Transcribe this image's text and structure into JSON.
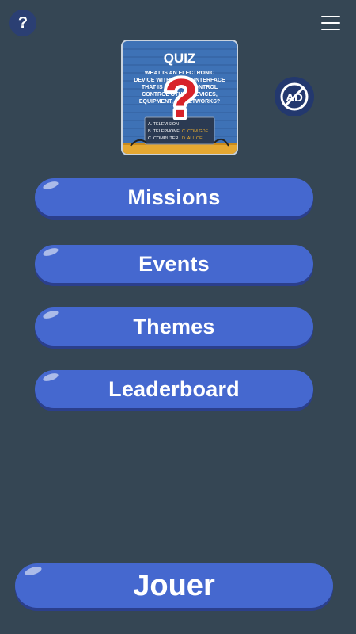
{
  "header": {
    "help_icon": "question-icon",
    "help_glyph": "?",
    "menu_icon": "hamburger-icon",
    "no_ads_icon": "no-ads-icon",
    "no_ads_text": "AD"
  },
  "logo": {
    "title": "QUIZ",
    "question_lines": [
      "WHAT IS AN ELECTRONIC",
      "DEVICE WITH A USER INTERFACE",
      "THAT IS USED TO CONTROL",
      "CONTROL OTHER DEVICES,",
      "EQUIPMENT, OR NETWORKS?"
    ],
    "answers": [
      "A. TELEVISION",
      "B. TELEPHONE",
      "C. COMPUTER",
      "C. COM GDF",
      "D. ALL OF"
    ],
    "overlay_icon": "red-question-mark-icon"
  },
  "menu": {
    "missions": "Missions",
    "events": "Events",
    "themes": "Themes",
    "leaderboard": "Leaderboard"
  },
  "play": {
    "label": "Jouer"
  },
  "colors": {
    "background": "#354654",
    "button": "#4568cf",
    "button_shadow": "#2b3f8c",
    "accent_dark": "#23386e"
  }
}
